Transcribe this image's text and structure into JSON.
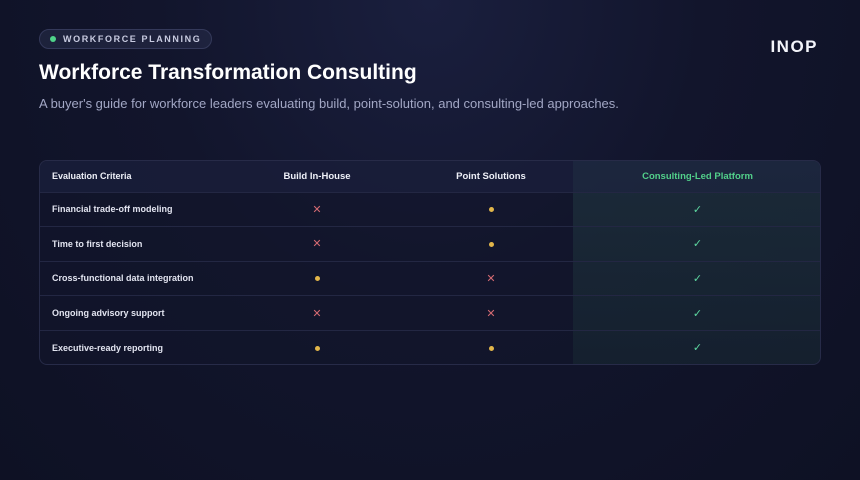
{
  "tag": {
    "label": "WORKFORCE PLANNING"
  },
  "brand": "INOP",
  "title": "Workforce Transformation Consulting",
  "subtitle": "A buyer's guide for workforce leaders evaluating build, point-solution, and consulting-led approaches.",
  "table": {
    "headers": [
      "Evaluation Criteria",
      "Build In-House",
      "Point Solutions",
      "Consulting-Led Platform"
    ],
    "highlight_color": "#52d08a",
    "rows": [
      {
        "label": "Financial trade-off modeling",
        "values": [
          "cross",
          "partial",
          "check"
        ]
      },
      {
        "label": "Time to first decision",
        "values": [
          "cross",
          "partial",
          "check"
        ]
      },
      {
        "label": "Cross-functional data integration",
        "values": [
          "partial",
          "cross",
          "check"
        ]
      },
      {
        "label": "Ongoing advisory support",
        "values": [
          "cross",
          "cross",
          "check"
        ]
      },
      {
        "label": "Executive-ready reporting",
        "values": [
          "partial",
          "partial",
          "check"
        ]
      }
    ]
  }
}
